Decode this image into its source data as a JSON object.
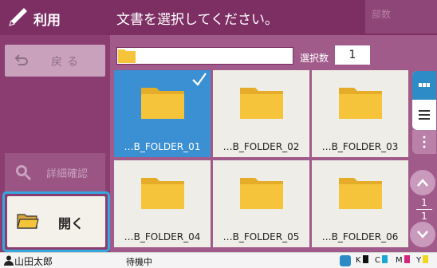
{
  "sidebar": {
    "title": "利用",
    "back_label": "戻る",
    "detail_label": "詳細確認",
    "open_label": "開く"
  },
  "header": {
    "title": "文書を選択してください。",
    "copies_label": "部数"
  },
  "toolbar": {
    "path_value": "",
    "selected_label": "選択数",
    "selected_count": "1"
  },
  "folders": [
    {
      "label": "…B_FOLDER_01",
      "selected": true
    },
    {
      "label": "…B_FOLDER_02",
      "selected": false
    },
    {
      "label": "…B_FOLDER_03",
      "selected": false
    },
    {
      "label": "…B_FOLDER_04",
      "selected": false
    },
    {
      "label": "…B_FOLDER_05",
      "selected": false
    },
    {
      "label": "…B_FOLDER_06",
      "selected": false
    }
  ],
  "pager": {
    "current": "1",
    "total": "1"
  },
  "status": {
    "user": "山田太郎",
    "state": "待機中",
    "inks": [
      {
        "name": "K",
        "color": "#111111"
      },
      {
        "name": "C",
        "color": "#19a7d8"
      },
      {
        "name": "M",
        "color": "#d6267c"
      },
      {
        "name": "Y",
        "color": "#f2d81c"
      }
    ]
  },
  "colors": {
    "header": "#7d2f64",
    "sidebar": "#8b3d71",
    "accent": "#35a8dd",
    "folder": "#f6c43a"
  },
  "icons": [
    "pencil-icon",
    "back-arrow-icon",
    "magnifier-icon",
    "open-folder-icon",
    "folder-icon",
    "checkmark-icon",
    "thumbnail-view-icon",
    "list-view-icon",
    "more-icon",
    "chevron-up-icon",
    "chevron-down-icon",
    "user-icon",
    "network-icon"
  ]
}
